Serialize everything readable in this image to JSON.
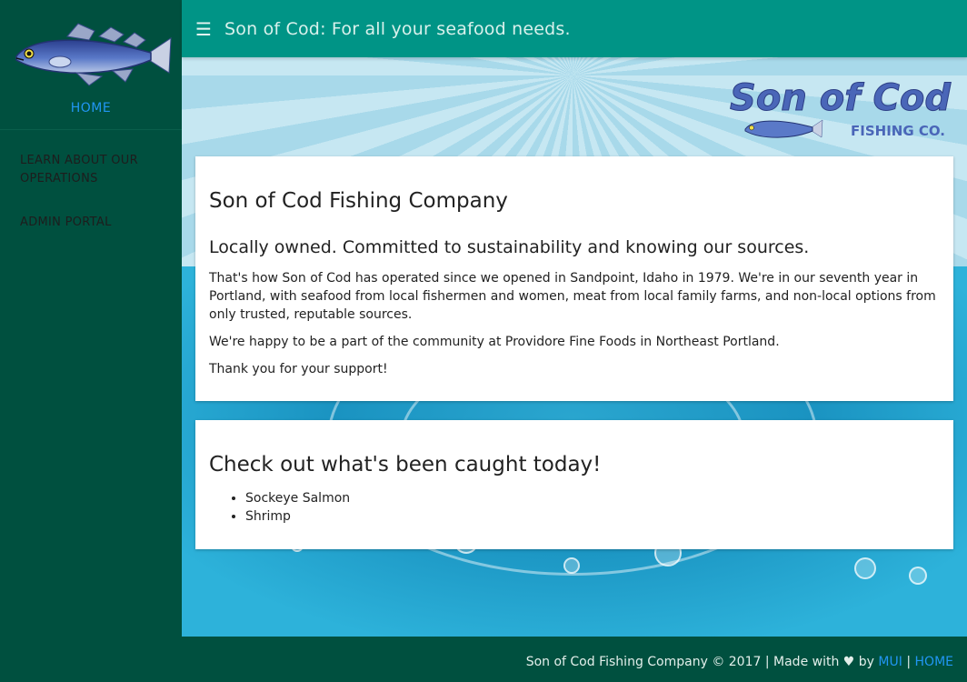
{
  "sidebar": {
    "home_label": "HOME",
    "items": [
      {
        "label": "LEARN ABOUT OUR OPERATIONS"
      },
      {
        "label": "ADMIN PORTAL"
      }
    ]
  },
  "header": {
    "menu_icon": "☰",
    "title": "Son of Cod: For all your seafood needs."
  },
  "logo": {
    "name": "Son of Cod",
    "tagline": "FISHING CO."
  },
  "card1": {
    "title": "Son of Cod Fishing Company",
    "subtitle": "Locally owned. Committed to sustainability and knowing our sources.",
    "paragraph1": "That's how Son of Cod has operated since we opened in Sandpoint, Idaho in 1979. We're in our seventh year in Portland, with seafood from local fishermen and women, meat from local family farms, and non-local options from only trusted, reputable sources.",
    "paragraph2": "We're happy to be a part of the community at Providore Fine Foods in Northeast Portland.",
    "paragraph3": "Thank you for your support!"
  },
  "card2": {
    "title": "Check out what's been caught today!",
    "items": [
      "Sockeye Salmon",
      "Shrimp"
    ]
  },
  "footer": {
    "text": "Son of Cod Fishing Company  © 2017 | Made with ♥ by ",
    "mui_link": "MUI",
    "separator": " | ",
    "home_link": "HOME"
  },
  "colors": {
    "appbar": "#009486",
    "sidebar": "#00503f",
    "link": "#2196f3"
  }
}
